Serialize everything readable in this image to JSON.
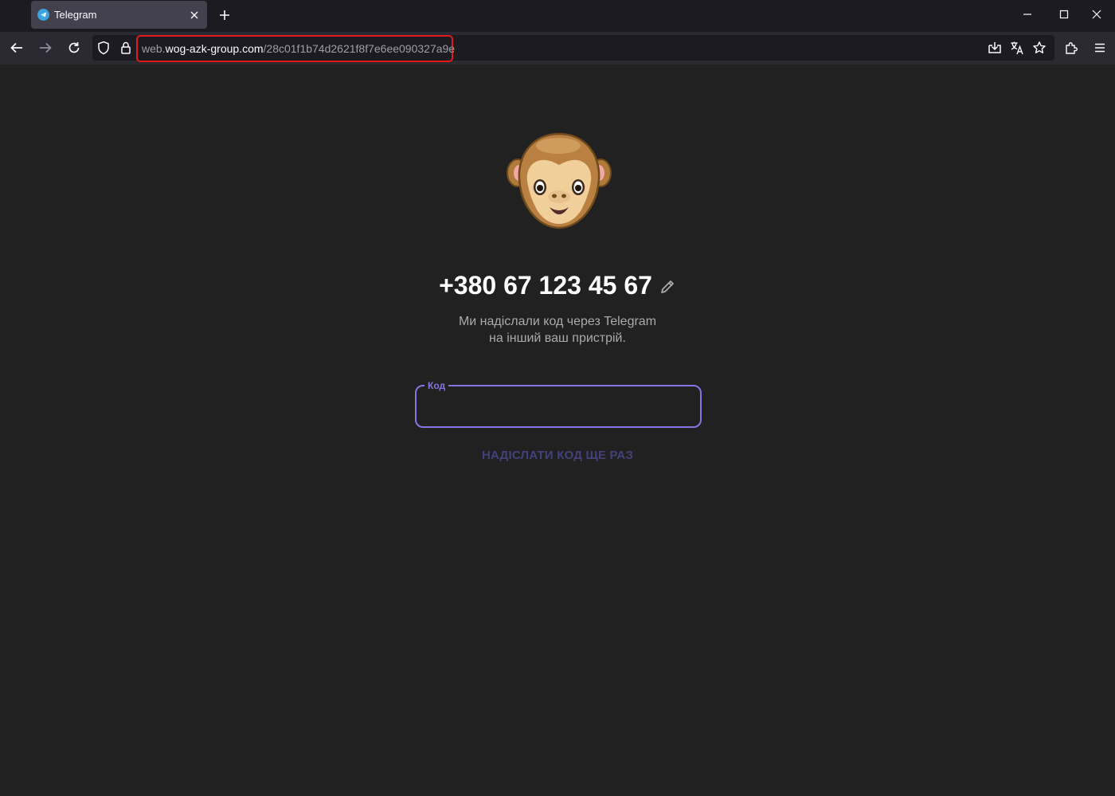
{
  "browser": {
    "tab_title": "Telegram",
    "url_prefix": "web.",
    "url_host": "wog-azk-group.com",
    "url_path": "/28c01f1b74d2621f8f7e6ee090327a9e"
  },
  "page": {
    "phone_number": "+380 67 123 45 67",
    "subtitle_line1": "Ми надіслали код через Telegram",
    "subtitle_line2": "на інший ваш пристрій.",
    "code_label": "Код",
    "code_value": "",
    "resend_label": "НАДІСЛАТИ КОД ЩЕ РАЗ"
  },
  "colors": {
    "accent": "#8774e1",
    "background": "#212121",
    "highlight_outline": "#e01a1a"
  }
}
